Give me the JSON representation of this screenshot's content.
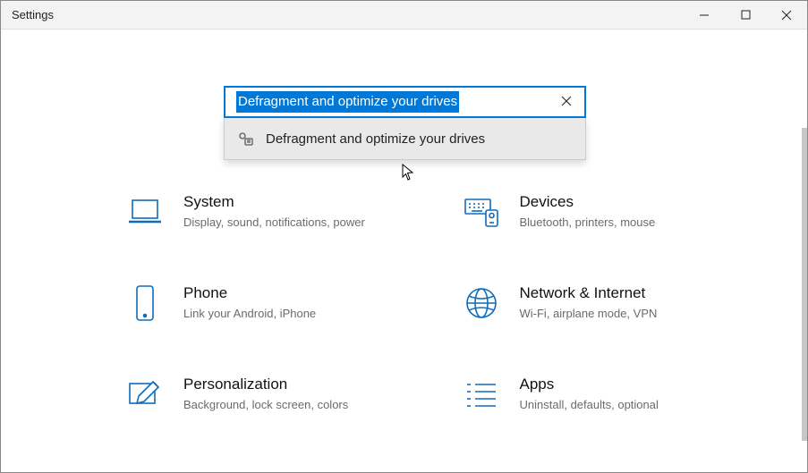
{
  "window": {
    "title": "Settings"
  },
  "search": {
    "value": "Defragment and optimize your drives",
    "suggestions": [
      {
        "label": "Defragment and optimize your drives",
        "icon": "gear-tool-icon"
      }
    ]
  },
  "tiles": [
    {
      "name": "System",
      "desc": "Display, sound, notifications, power",
      "icon": "laptop-icon"
    },
    {
      "name": "Devices",
      "desc": "Bluetooth, printers, mouse",
      "icon": "keyboard-icon"
    },
    {
      "name": "Phone",
      "desc": "Link your Android, iPhone",
      "icon": "phone-icon"
    },
    {
      "name": "Network & Internet",
      "desc": "Wi-Fi, airplane mode, VPN",
      "icon": "globe-icon"
    },
    {
      "name": "Personalization",
      "desc": "Background, lock screen, colors",
      "icon": "pen-icon"
    },
    {
      "name": "Apps",
      "desc": "Uninstall, defaults, optional",
      "icon": "apps-icon"
    }
  ]
}
